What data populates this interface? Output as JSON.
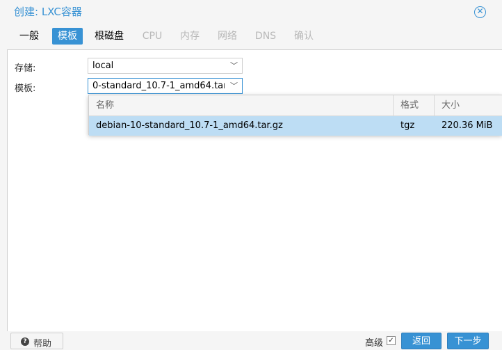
{
  "window": {
    "title": "创建: LXC容器"
  },
  "tabs": [
    {
      "label": "一般",
      "state": "normal"
    },
    {
      "label": "模板",
      "state": "active"
    },
    {
      "label": "根磁盘",
      "state": "normal"
    },
    {
      "label": "CPU",
      "state": "disabled"
    },
    {
      "label": "内存",
      "state": "disabled"
    },
    {
      "label": "网络",
      "state": "disabled"
    },
    {
      "label": "DNS",
      "state": "disabled"
    },
    {
      "label": "确认",
      "state": "disabled"
    }
  ],
  "form": {
    "storage": {
      "label": "存储:",
      "value": "local"
    },
    "template": {
      "label": "模板:",
      "value": "0-standard_10.7-1_amd64.tar.gz"
    }
  },
  "dropdown": {
    "columns": [
      "名称",
      "格式",
      "大小"
    ],
    "rows": [
      {
        "name": "debian-10-standard_10.7-1_amd64.tar.gz",
        "format": "tgz",
        "size": "220.36 MiB",
        "selected": true
      }
    ]
  },
  "footer": {
    "help_label": "帮助",
    "advanced_label": "高级",
    "advanced_checked": true,
    "back_label": "返回",
    "next_label": "下一步"
  },
  "colors": {
    "accent": "#3892d4",
    "selected_row": "#bdddf4",
    "disabled_text": "#b8b8b8"
  },
  "icons": {
    "close": "close-circle-icon",
    "combo_arrow": "chevron-down-icon",
    "help": "question-circle-icon",
    "checkbox": "checkmark-icon"
  }
}
